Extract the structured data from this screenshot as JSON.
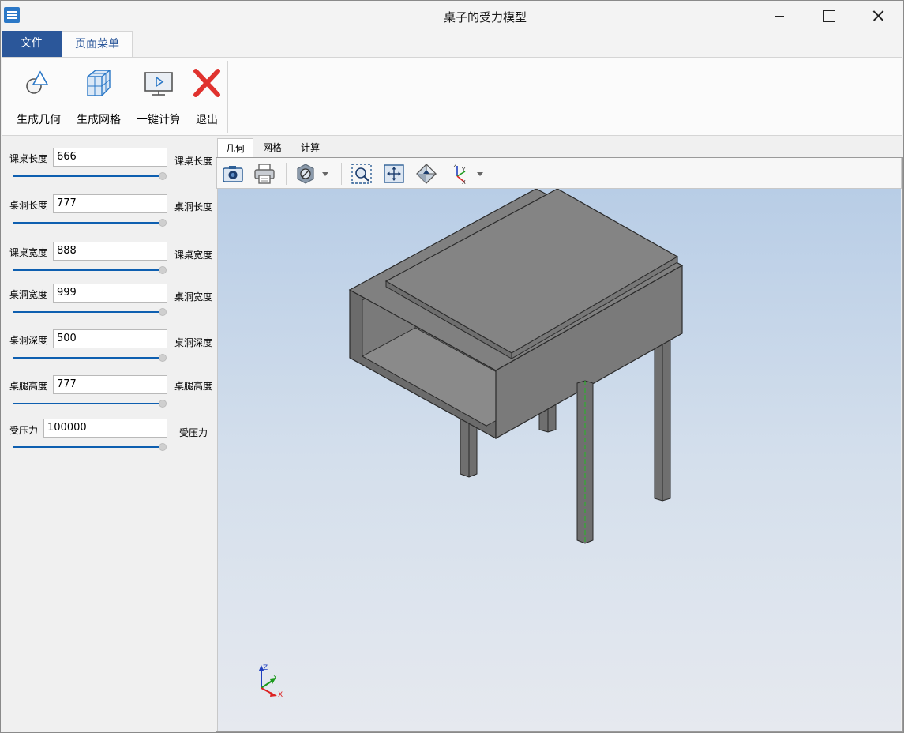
{
  "window": {
    "title": "桌子的受力模型"
  },
  "ribbon_tabs": {
    "file": "文件",
    "page_menu": "页面菜单"
  },
  "ribbon": {
    "gen_geometry": "生成几何",
    "gen_mesh": "生成网格",
    "one_click_calc": "一键计算",
    "exit": "退出"
  },
  "params": [
    {
      "label": "课桌长度",
      "value": "666",
      "unit": "课桌长度"
    },
    {
      "label": "桌洞长度",
      "value": "777",
      "unit": "桌洞长度"
    },
    {
      "label": "课桌宽度",
      "value": "888",
      "unit": "课桌宽度"
    },
    {
      "label": "桌洞宽度",
      "value": "999",
      "unit": "桌洞宽度"
    },
    {
      "label": "桌洞深度",
      "value": "500",
      "unit": "桌洞深度"
    },
    {
      "label": "桌腿高度",
      "value": "777",
      "unit": "桌腿高度"
    },
    {
      "label": "受压力",
      "value": "100000",
      "unit": "受压力"
    }
  ],
  "view_tabs": [
    "几何",
    "网格",
    "计算"
  ],
  "toolbar_icons": [
    "camera-icon",
    "print-icon",
    "display-mode-icon",
    "zoom-window-icon",
    "fit-all-icon",
    "view-orient-icon",
    "axis-view-icon"
  ],
  "triad": {
    "x": "X",
    "y": "Y",
    "z": "Z"
  },
  "colors": {
    "accent": "#2b579a",
    "slider": "#0e5fb0",
    "model_gray": "#7f7f7f"
  }
}
